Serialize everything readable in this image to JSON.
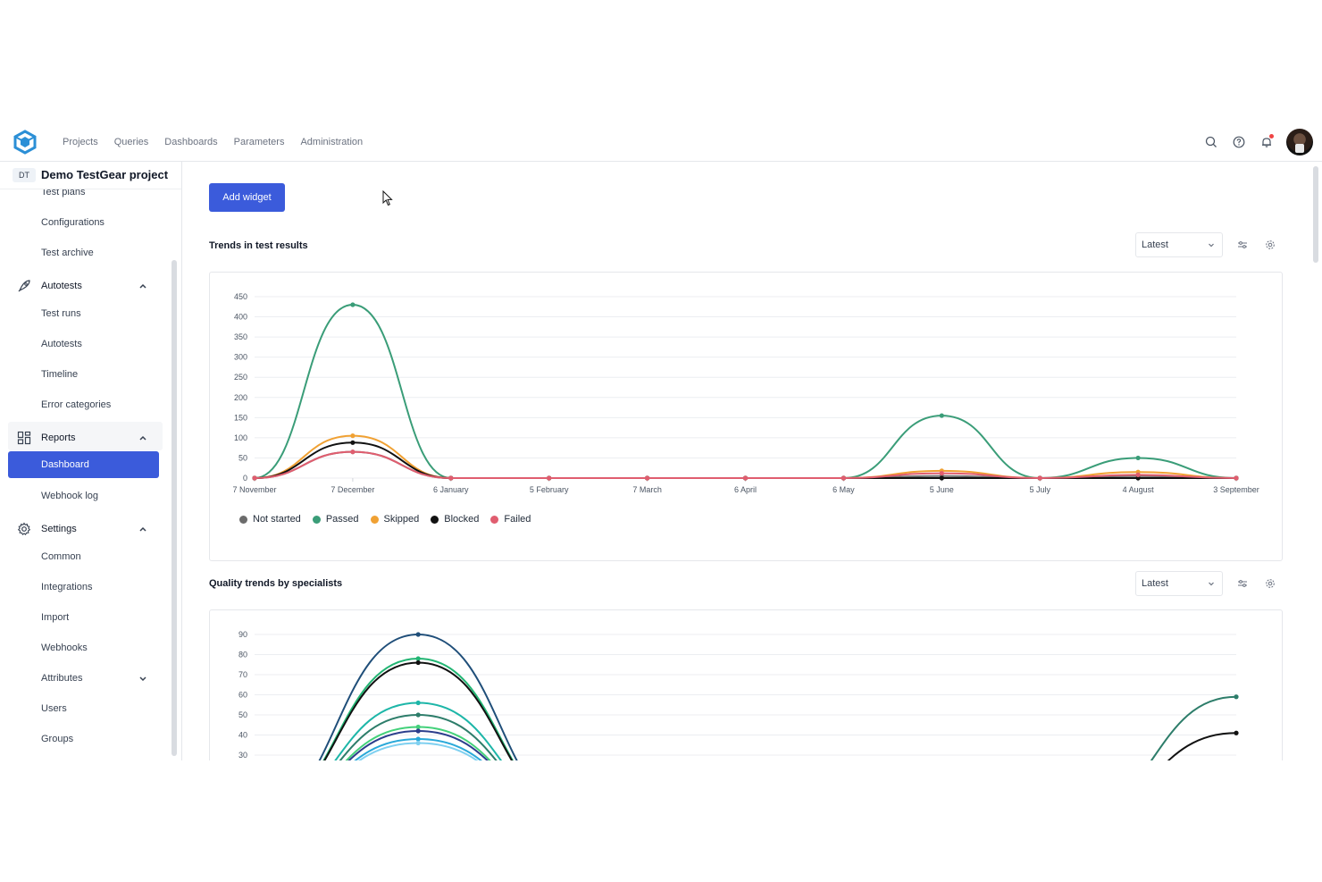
{
  "nav": {
    "items": [
      "Projects",
      "Queries",
      "Dashboards",
      "Parameters",
      "Administration"
    ]
  },
  "project": {
    "badge": "DT",
    "name": "Demo TestGear project"
  },
  "sidebar": {
    "test_plans": "Test plans",
    "configurations": "Configurations",
    "test_archive": "Test archive",
    "autotests_group": "Autotests",
    "test_runs": "Test runs",
    "autotests": "Autotests",
    "timeline": "Timeline",
    "error_categories": "Error categories",
    "reports_group": "Reports",
    "dashboard": "Dashboard",
    "webhook_log": "Webhook log",
    "settings_group": "Settings",
    "common": "Common",
    "integrations": "Integrations",
    "import": "Import",
    "webhooks": "Webhooks",
    "attributes": "Attributes",
    "users": "Users",
    "groups": "Groups"
  },
  "main": {
    "add_widget": "Add widget",
    "widget1": {
      "title": "Trends in test results",
      "select": "Latest"
    },
    "widget2": {
      "title": "Quality trends by specialists",
      "select": "Latest"
    }
  },
  "colors": {
    "accent": "#3b5bdb",
    "passed": "#3a9d78",
    "skipped": "#f0a133",
    "blocked": "#111111",
    "not_started": "#6b6b6b",
    "failed": "#e05d6f"
  },
  "chart_data": [
    {
      "type": "line",
      "title": "Trends in test results",
      "categories": [
        "7 November",
        "7 December",
        "6 January",
        "5 February",
        "7 March",
        "6 April",
        "6 May",
        "5 June",
        "5 July",
        "4 August",
        "3 September"
      ],
      "ylim": [
        0,
        450
      ],
      "yticks": [
        0,
        50,
        100,
        150,
        200,
        250,
        300,
        350,
        400,
        450
      ],
      "grid": true,
      "legend": "bottom-left",
      "series": [
        {
          "name": "Not started",
          "color": "#6b6b6b",
          "values": [
            0,
            65,
            0,
            0,
            0,
            0,
            0,
            5,
            0,
            5,
            0
          ]
        },
        {
          "name": "Passed",
          "color": "#3a9d78",
          "values": [
            0,
            430,
            0,
            0,
            0,
            0,
            0,
            155,
            0,
            50,
            0
          ]
        },
        {
          "name": "Skipped",
          "color": "#f0a133",
          "values": [
            0,
            105,
            0,
            0,
            0,
            0,
            0,
            18,
            0,
            15,
            0
          ]
        },
        {
          "name": "Blocked",
          "color": "#111111",
          "values": [
            0,
            88,
            0,
            0,
            0,
            0,
            0,
            0,
            0,
            0,
            0
          ]
        },
        {
          "name": "Failed",
          "color": "#e05d6f",
          "values": [
            0,
            65,
            0,
            0,
            0,
            0,
            0,
            12,
            0,
            8,
            0
          ]
        }
      ]
    },
    {
      "type": "line",
      "title": "Quality trends by specialists",
      "ylim": [
        30,
        90
      ],
      "yticks": [
        30,
        40,
        50,
        60,
        70,
        80,
        90
      ],
      "grid": true,
      "series": [
        {
          "color": "#1f4e79",
          "values": [
            0,
            90,
            0,
            0,
            0,
            0,
            0
          ]
        },
        {
          "color": "#22b573",
          "values": [
            0,
            78,
            0,
            0,
            0,
            0,
            0
          ]
        },
        {
          "color": "#111111",
          "values": [
            0,
            76,
            0,
            0,
            0,
            0,
            41
          ]
        },
        {
          "color": "#1db6a8",
          "values": [
            0,
            56,
            0,
            0,
            0,
            0,
            0
          ]
        },
        {
          "color": "#2d7d6a",
          "values": [
            0,
            50,
            0,
            0,
            0,
            0,
            59
          ]
        },
        {
          "color": "#43d17a",
          "values": [
            0,
            44,
            0,
            0,
            0,
            0,
            0
          ]
        },
        {
          "color": "#2c3e8c",
          "values": [
            0,
            42,
            0,
            0,
            0,
            0,
            0
          ]
        },
        {
          "color": "#2aa9d9",
          "values": [
            0,
            38,
            0,
            0,
            0,
            0,
            0
          ]
        },
        {
          "color": "#7fd0f0",
          "values": [
            0,
            36,
            0,
            0,
            0,
            0,
            0
          ]
        }
      ]
    }
  ]
}
